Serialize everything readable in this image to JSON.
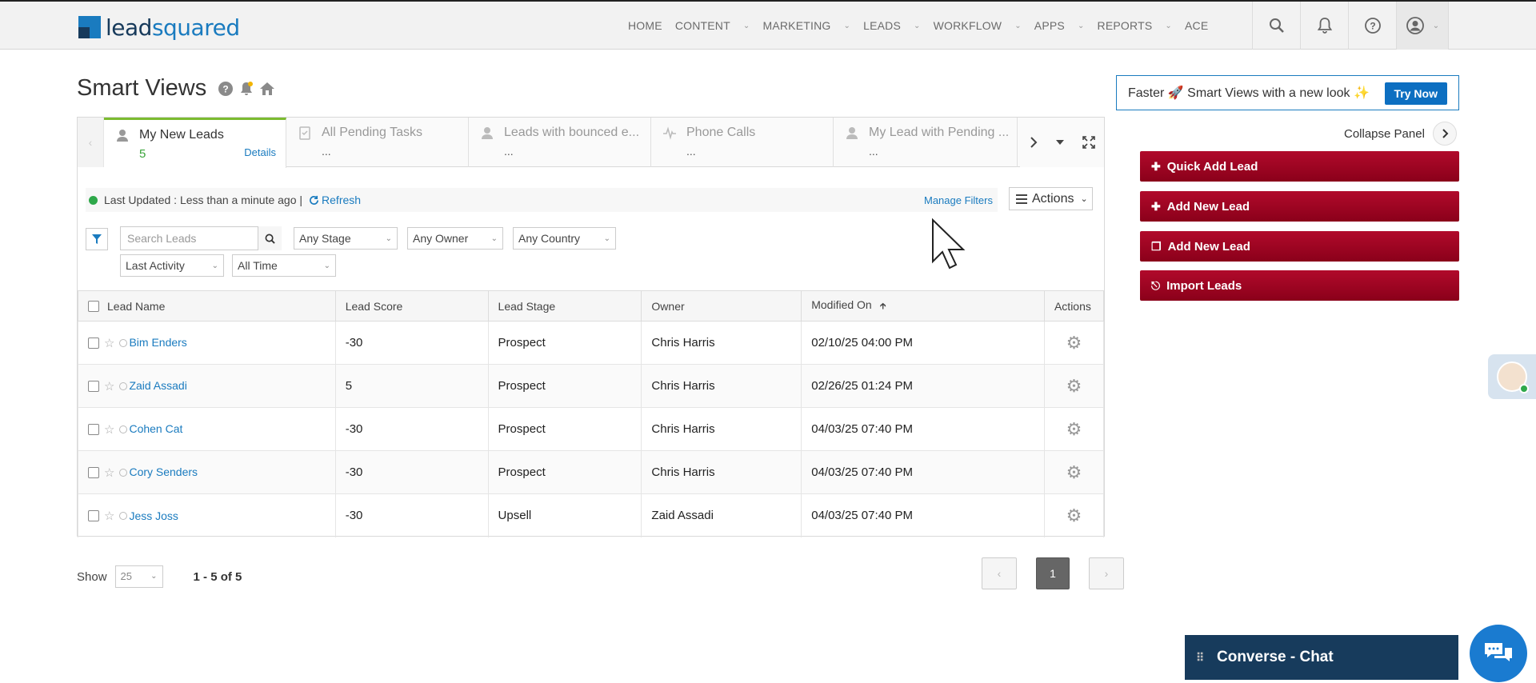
{
  "header": {
    "logo": {
      "lead": "lead",
      "squared": "squared"
    },
    "nav": [
      {
        "label": "HOME",
        "caret": false
      },
      {
        "label": "CONTENT",
        "caret": true
      },
      {
        "label": "MARKETING",
        "caret": true
      },
      {
        "label": "LEADS",
        "caret": true
      },
      {
        "label": "WORKFLOW",
        "caret": true
      },
      {
        "label": "APPS",
        "caret": true
      },
      {
        "label": "REPORTS",
        "caret": true
      },
      {
        "label": "ACE",
        "caret": false
      }
    ],
    "icons": [
      "search-icon",
      "notification-bell-icon",
      "help-icon",
      "user-profile-icon"
    ]
  },
  "page": {
    "title": "Smart Views",
    "title_icons": [
      "help-icon",
      "bell-icon",
      "home-icon"
    ]
  },
  "promo": {
    "text": "Faster 🚀 Smart Views with a new look ✨",
    "cta": "Try Now"
  },
  "panel": {
    "collapse_label": "Collapse Panel",
    "buttons": [
      {
        "label": "Quick Add Lead",
        "icon": "plus-icon"
      },
      {
        "label": "Add New Lead",
        "icon": "plus-icon"
      },
      {
        "label": "Add New Lead",
        "icon": "copy-icon"
      },
      {
        "label": "Import Leads",
        "icon": "import-icon"
      }
    ]
  },
  "tabs": [
    {
      "label": "My New Leads",
      "sub": "5",
      "details": "Details",
      "active": true,
      "icon": "person-icon"
    },
    {
      "label": "All Pending Tasks",
      "sub": "...",
      "active": false,
      "icon": "task-icon"
    },
    {
      "label": "Leads with bounced e...",
      "sub": "...",
      "active": false,
      "icon": "person-icon"
    },
    {
      "label": "Phone Calls",
      "sub": "...",
      "active": false,
      "icon": "pulse-icon"
    },
    {
      "label": "My Lead with Pending ...",
      "sub": "...",
      "active": false,
      "icon": "person-icon"
    }
  ],
  "status": {
    "last_updated": "Last Updated : Less than a minute ago |",
    "refresh": "Refresh",
    "manage_filters": "Manage Filters",
    "actions": "Actions"
  },
  "filters": {
    "search_placeholder": "Search Leads",
    "stage": "Any Stage",
    "owner": "Any Owner",
    "country": "Any Country",
    "activity": "Last Activity",
    "time": "All Time"
  },
  "table": {
    "columns": [
      "Lead Name",
      "Lead Score",
      "Lead Stage",
      "Owner",
      "Modified On",
      "Actions"
    ],
    "rows": [
      {
        "name": "Bim Enders",
        "score": "-30",
        "stage": "Prospect",
        "owner": "Chris Harris",
        "modified": "02/10/25 04:00 PM"
      },
      {
        "name": "Zaid Assadi",
        "score": "5",
        "stage": "Prospect",
        "owner": "Chris Harris",
        "modified": "02/26/25 01:24 PM"
      },
      {
        "name": "Cohen Cat",
        "score": "-30",
        "stage": "Prospect",
        "owner": "Chris Harris",
        "modified": "04/03/25 07:40 PM"
      },
      {
        "name": "Cory Senders",
        "score": "-30",
        "stage": "Prospect",
        "owner": "Chris Harris",
        "modified": "04/03/25 07:40 PM"
      },
      {
        "name": "Jess Joss",
        "score": "-30",
        "stage": "Upsell",
        "owner": "Zaid Assadi",
        "modified": "04/03/25 07:40 PM"
      }
    ]
  },
  "footer": {
    "show_label": "Show",
    "page_size": "25",
    "range": "1 - 5 of 5",
    "current_page": "1"
  },
  "chat": {
    "label": "Converse - Chat"
  },
  "colors": {
    "brand_blue": "#1a7bbf",
    "cta_red": "#a3001f",
    "active_tab": "#7bbb2f",
    "chat_navy": "#173b5c"
  }
}
